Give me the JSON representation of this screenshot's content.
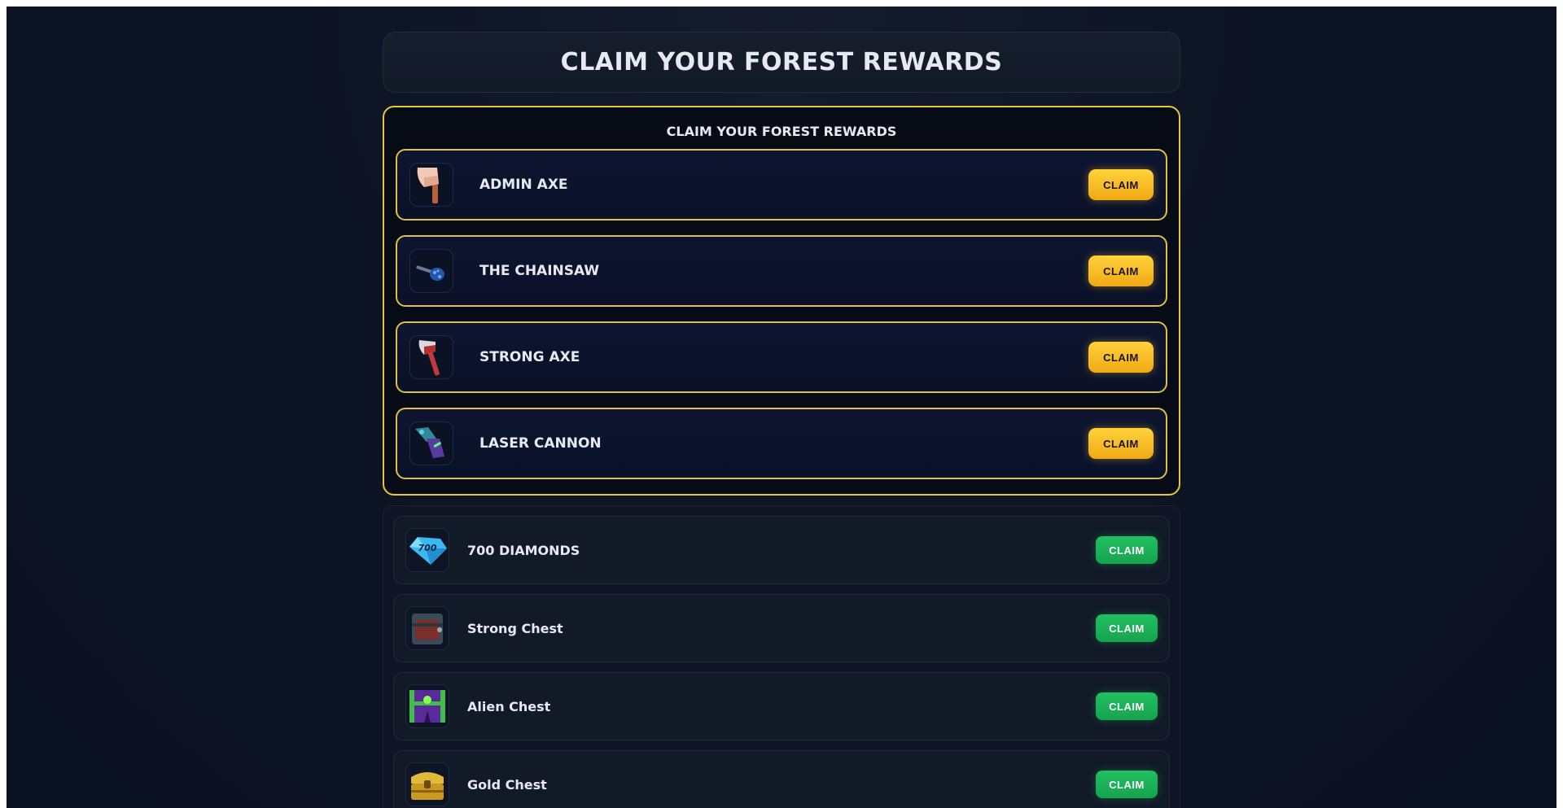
{
  "header": {
    "title": "CLAIM YOUR FOREST REWARDS"
  },
  "featured": {
    "title": "CLAIM YOUR FOREST REWARDS",
    "items": [
      {
        "name": "ADMIN AXE",
        "button": "CLAIM",
        "icon": "admin-axe-icon"
      },
      {
        "name": "THE CHAINSAW",
        "button": "CLAIM",
        "icon": "chainsaw-icon"
      },
      {
        "name": "STRONG AXE",
        "button": "CLAIM",
        "icon": "strong-axe-icon"
      },
      {
        "name": "LASER CANNON",
        "button": "CLAIM",
        "icon": "laser-cannon-icon"
      }
    ]
  },
  "rewards": {
    "items": [
      {
        "name": "700 DIAMONDS",
        "button": "CLAIM",
        "icon": "diamond-icon",
        "badge": "700"
      },
      {
        "name": "Strong Chest",
        "button": "CLAIM",
        "icon": "strong-chest-icon"
      },
      {
        "name": "Alien Chest",
        "button": "CLAIM",
        "icon": "alien-chest-icon"
      },
      {
        "name": "Gold Chest",
        "button": "CLAIM",
        "icon": "gold-chest-icon"
      }
    ]
  },
  "colors": {
    "accent_gold": "#e8c53a",
    "claim_gold": "#f5b91f",
    "claim_green": "#1fb35a",
    "background": "#0d1424"
  }
}
